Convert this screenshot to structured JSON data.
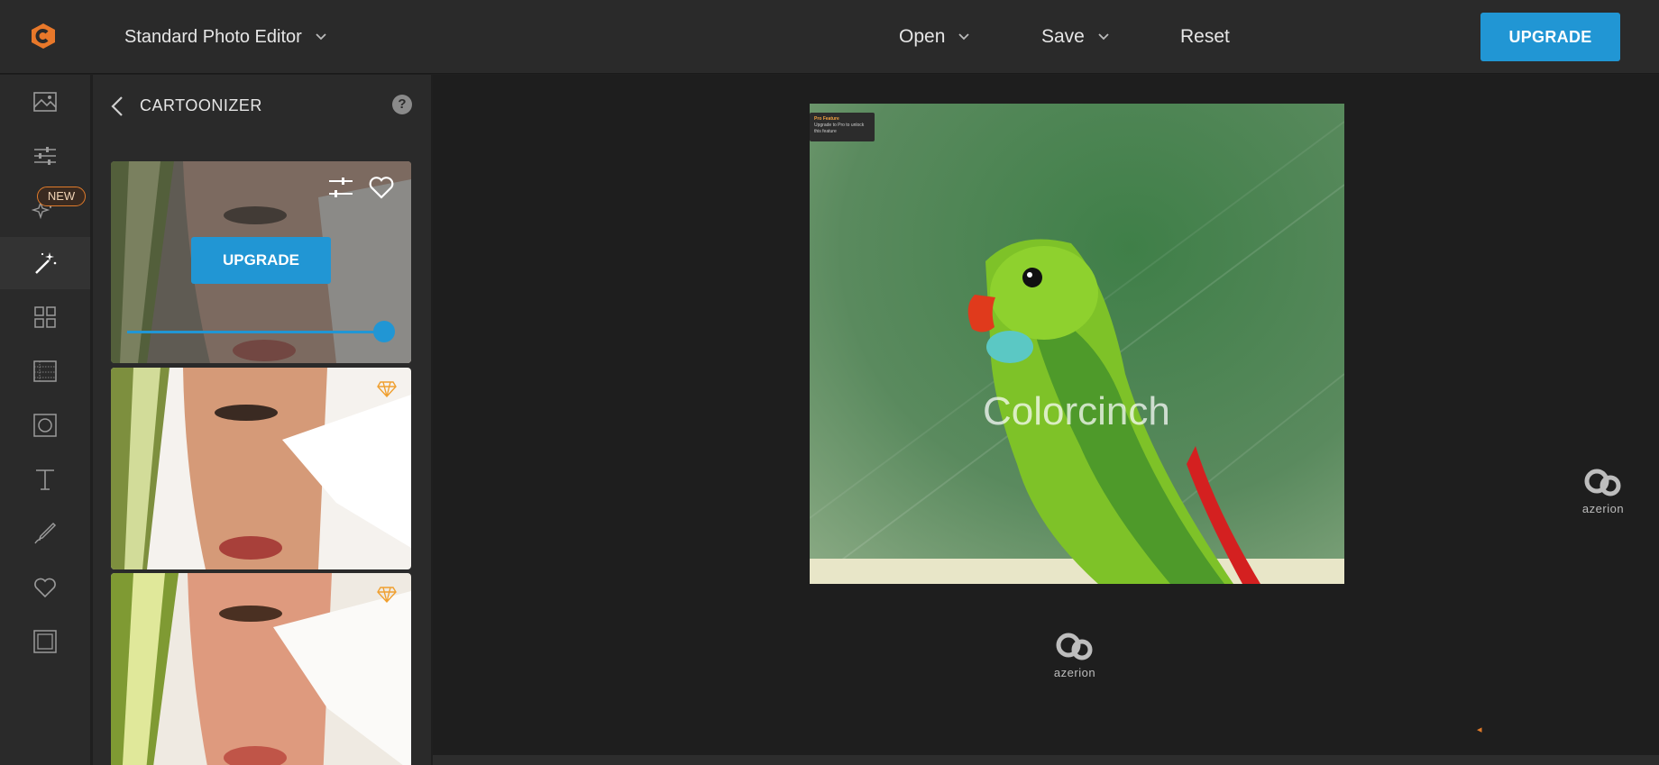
{
  "topbar": {
    "editor_mode": "Standard Photo Editor",
    "open_label": "Open",
    "save_label": "Save",
    "reset_label": "Reset",
    "upgrade_label": "UPGRADE",
    "brand_color": "#e8782a",
    "accent_color": "#2196d4"
  },
  "rail": {
    "new_badge": "NEW",
    "items": [
      {
        "icon": "image-icon"
      },
      {
        "icon": "sliders-icon"
      },
      {
        "icon": "sparkles-icon"
      },
      {
        "icon": "magic-wand-icon",
        "active": true
      },
      {
        "icon": "grid-icon"
      },
      {
        "icon": "texture-icon"
      },
      {
        "icon": "frame-circle-icon"
      },
      {
        "icon": "text-icon"
      },
      {
        "icon": "brush-icon"
      },
      {
        "icon": "heart-icon"
      },
      {
        "icon": "frame-icon"
      }
    ]
  },
  "panel": {
    "title": "CARTOONIZER",
    "help": "?",
    "upgrade_label": "UPGRADE",
    "effect_strength": 1.0
  },
  "canvas": {
    "watermark": "Colorcinch",
    "pro_tip_title": "Pro Feature",
    "pro_tip_text": "Upgrade to Pro to unlock this feature"
  },
  "ads": {
    "brand_left": "azerion",
    "brand_right": "azerion"
  }
}
